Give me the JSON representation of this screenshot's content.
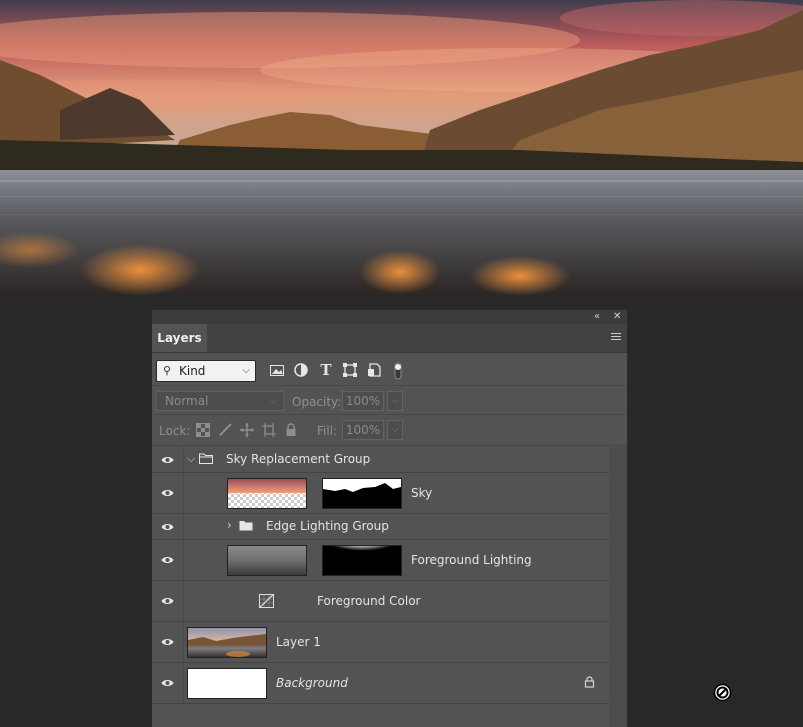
{
  "panel": {
    "collapse_glyph": "«",
    "close_glyph": "✕",
    "tab_label": "Layers",
    "menu_icon": "hamburger-menu-icon"
  },
  "filter": {
    "kind_label": "Kind",
    "icons": [
      "image-filter-icon",
      "adjustment-filter-icon",
      "type-filter-icon",
      "shape-filter-icon",
      "smart-object-filter-icon",
      "filter-toggle-icon"
    ]
  },
  "blend": {
    "mode": "Normal",
    "opacity_label": "Opacity:",
    "opacity_value": "100%"
  },
  "lock": {
    "label": "Lock:",
    "fill_label": "Fill:",
    "fill_value": "100%",
    "icons": [
      "lock-transparent-pixels-icon",
      "lock-image-pixels-icon",
      "lock-position-icon",
      "lock-artboard-icon",
      "lock-all-icon"
    ]
  },
  "layers": [
    {
      "name": "Sky Replacement Group",
      "type": "group",
      "expanded": true
    },
    {
      "name": "Sky",
      "type": "image-with-mask"
    },
    {
      "name": "Edge Lighting Group",
      "type": "group",
      "expanded": false
    },
    {
      "name": "Foreground Lighting",
      "type": "image-with-mask"
    },
    {
      "name": "Foreground Color",
      "type": "adjustment"
    },
    {
      "name": "Layer 1",
      "type": "image"
    },
    {
      "name": "Background",
      "type": "background",
      "locked": true
    }
  ],
  "colors": {
    "panel_bg": "#535353",
    "workspace_bg": "#282828"
  }
}
